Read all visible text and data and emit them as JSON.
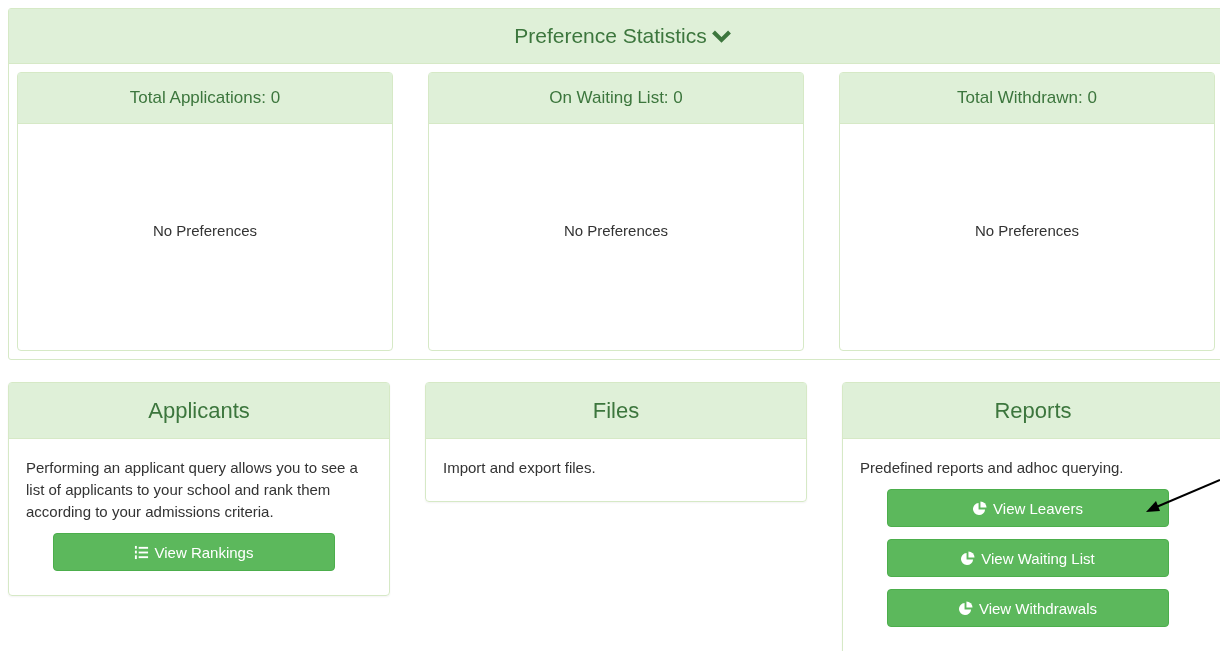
{
  "statistics": {
    "title": "Preference Statistics",
    "cards": [
      {
        "title": "Total Applications: 0",
        "body": "No Preferences"
      },
      {
        "title": "On Waiting List: 0",
        "body": "No Preferences"
      },
      {
        "title": "Total Withdrawn: 0",
        "body": "No Preferences"
      }
    ]
  },
  "panels": [
    {
      "title": "Applicants",
      "description": "Performing an applicant query allows you to see a list of applicants to your school and rank them according to your admissions criteria.",
      "buttons": [
        {
          "label": "View Rankings",
          "kind": "list"
        }
      ]
    },
    {
      "title": "Files",
      "description": "Import and export files."
    },
    {
      "title": "Reports",
      "description": "Predefined reports and adhoc querying.",
      "buttons": [
        {
          "label": "View Leavers",
          "kind": "report"
        },
        {
          "label": "View Waiting List",
          "kind": "report"
        },
        {
          "label": "View Withdrawals",
          "kind": "report"
        }
      ]
    }
  ]
}
